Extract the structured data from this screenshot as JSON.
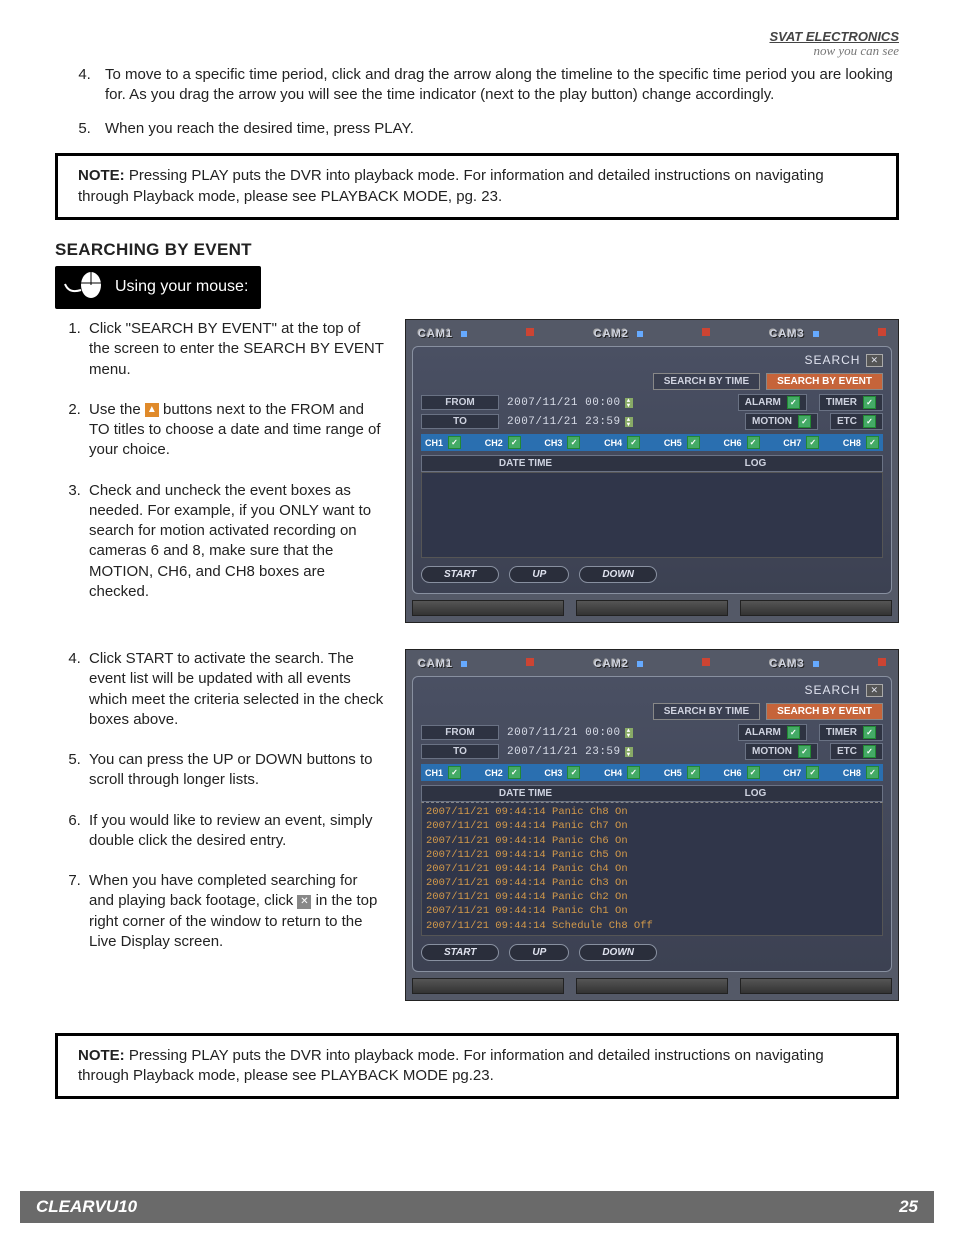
{
  "header": {
    "brand": "SVAT ELECTRONICS",
    "tagline": "now you can see"
  },
  "intro_steps": {
    "start": 4,
    "items": [
      "To move to a specific time period, click and drag the arrow along the timeline to the specific time period you are looking for.  As you drag the arrow you will see the time indicator (next to the play button) change accordingly.",
      "When you reach the desired time, press PLAY."
    ]
  },
  "note1": {
    "label": "NOTE:",
    "text": "  Pressing PLAY puts the DVR into playback mode.  For information and detailed instructions on navigating through Playback mode, please see PLAYBACK MODE, pg. 23."
  },
  "section_title": "SEARCHING BY EVENT",
  "mouse_box": "Using your mouse:",
  "left_steps_a": {
    "start": 1,
    "items": [
      "Click \"SEARCH BY EVENT\" at the top of the screen to enter the SEARCH BY EVENT menu.",
      "Use the __ICON__ buttons next to the FROM and TO titles to choose a date and time range of your choice.",
      "Check and uncheck the event boxes as needed. For example, if you ONLY want to search for motion activated recording on cameras 6 and 8, make sure that the MOTION, CH6, and CH8 boxes are checked."
    ]
  },
  "left_steps_b": {
    "start": 4,
    "items": [
      "Click START to activate the search.  The event list will be updated with all events which meet the criteria selected in the check boxes above.",
      "You can press the UP or DOWN buttons to scroll through longer lists.",
      "If you would like to review an event, simply double click the desired entry.",
      "When you have completed searching for and playing back footage, click __X__ in the top right corner of the window to return to the Live Display screen."
    ]
  },
  "note2": {
    "label": "NOTE:",
    "text": "  Pressing PLAY puts the DVR into playback mode.  For information and detailed instructions on navigating through Playback mode, please see PLAYBACK MODE pg.23."
  },
  "dvr": {
    "cams": [
      "CAM1",
      "CAM2",
      "CAM3"
    ],
    "search_label": "SEARCH",
    "tab_time": "SEARCH BY TIME",
    "tab_event": "SEARCH BY EVENT",
    "from_label": "FROM",
    "to_label": "TO",
    "from_value": "2007/11/21 00:00",
    "to_value": "2007/11/21 23:59",
    "filters": {
      "alarm": "ALARM",
      "timer": "TIMER",
      "motion": "MOTION",
      "etc": "ETC"
    },
    "channels": [
      "CH1",
      "CH2",
      "CH3",
      "CH4",
      "CH5",
      "CH6",
      "CH7",
      "CH8"
    ],
    "col_datetime": "DATE TIME",
    "col_log": "LOG",
    "btn_start": "START",
    "btn_up": "UP",
    "btn_down": "DOWN",
    "log_rows": [
      "2007/11/21 09:44:14 Panic Ch8 On",
      "2007/11/21 09:44:14 Panic Ch7 On",
      "2007/11/21 09:44:14 Panic Ch6 On",
      "2007/11/21 09:44:14 Panic Ch5 On",
      "2007/11/21 09:44:14 Panic Ch4 On",
      "2007/11/21 09:44:14 Panic Ch3 On",
      "2007/11/21 09:44:14 Panic Ch2 On",
      "2007/11/21 09:44:14 Panic Ch1 On",
      "2007/11/21 09:44:14 Schedule Ch8 Off"
    ]
  },
  "footer": {
    "model": "CLEARVU10",
    "page": "25"
  }
}
